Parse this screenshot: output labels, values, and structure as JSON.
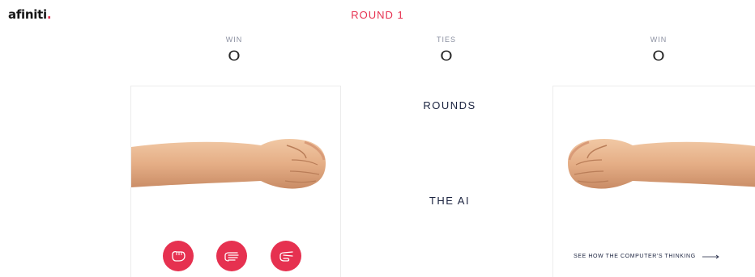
{
  "brand": {
    "logo_text": "afiniti",
    "logo_dot": "."
  },
  "round": {
    "title": "ROUND 1"
  },
  "scores": [
    {
      "label": "WIN",
      "value": "O"
    },
    {
      "label": "TIES",
      "value": "O"
    },
    {
      "label": "WIN",
      "value": "O"
    }
  ],
  "center": {
    "rounds_label": "ROUNDS",
    "ai_label": "THE AI"
  },
  "player": {
    "hand": "rock",
    "choices": [
      {
        "name": "rock",
        "icon": "rock-hand-icon"
      },
      {
        "name": "paper",
        "icon": "paper-hand-icon"
      },
      {
        "name": "scissors",
        "icon": "scissors-hand-icon"
      }
    ]
  },
  "computer": {
    "hand": "rock",
    "link_text": "SEE HOW THE COMPUTER'S THINKING"
  },
  "colors": {
    "accent": "#e63150",
    "text": "#1c2440",
    "muted": "#8a8fa0",
    "skin": "#e9b690"
  }
}
